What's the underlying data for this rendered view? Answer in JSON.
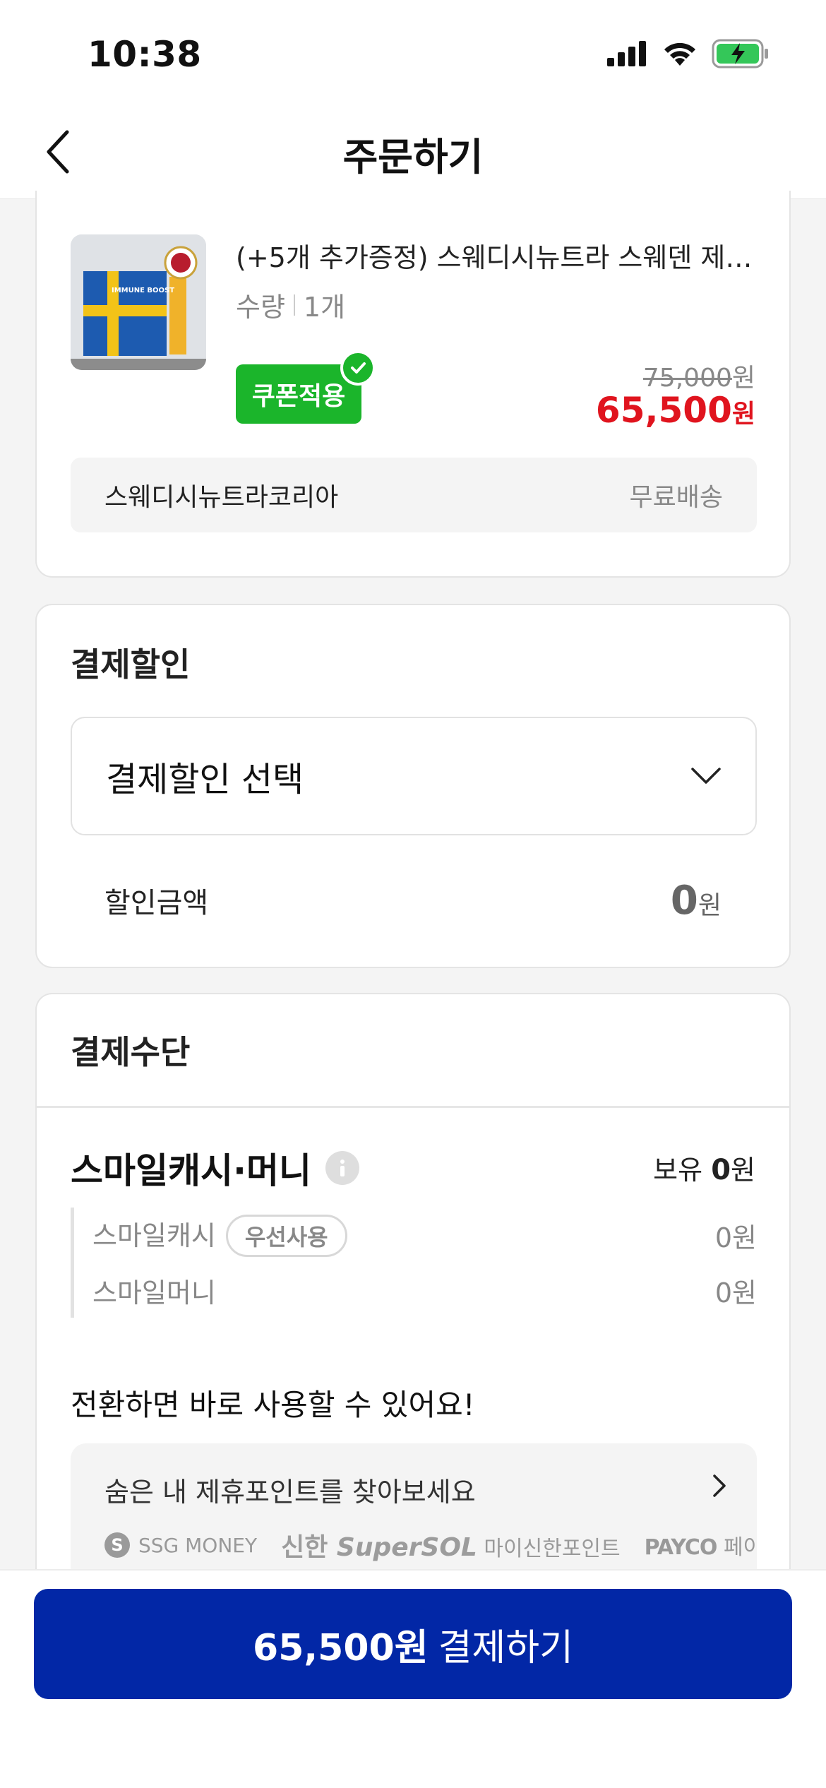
{
  "status_bar": {
    "time": "10:38"
  },
  "header": {
    "title": "주문하기"
  },
  "product": {
    "title": "(+5개 추가증정) 스웨디시뉴트라 스웨덴 제…",
    "qty_label": "수량",
    "qty_value": "1개",
    "coupon_badge": "쿠폰적용",
    "original_price": "75,000",
    "original_unit": "원",
    "sale_price": "65,500",
    "sale_unit": "원",
    "seller": "스웨디시뉴트라코리아",
    "shipping": "무료배송",
    "thumbnail_text": "IMMUNE BOOST"
  },
  "payment_discount": {
    "title": "결제할인",
    "select_placeholder": "결제할인 선택",
    "amount_label": "할인금액",
    "amount_value": "0",
    "amount_unit": "원"
  },
  "payment_method": {
    "title": "결제수단",
    "smile_title": "스마일캐시·머니",
    "hold_label": "보유",
    "hold_value": "0",
    "hold_unit": "원",
    "items": [
      {
        "label": "스마일캐시",
        "tag": "우선사용",
        "value": "0원"
      },
      {
        "label": "스마일머니",
        "tag": "",
        "value": "0원"
      }
    ],
    "convert_title": "전환하면 바로 사용할 수 있어요!",
    "promo_text": "숨은 내 제휴포인트를 찾아보세요",
    "partners": {
      "ssg": "SSG MONEY",
      "shinhan_brand": "신한",
      "shinhan_super": "Super",
      "shinhan_sol": "SOL",
      "shinhan_point": "마이신한포인트",
      "payco": "PAYCO",
      "payco_suffix": "페이코"
    }
  },
  "cta": {
    "amount": "65,500원",
    "label": "결제하기"
  },
  "colors": {
    "accent": "#0227a6",
    "coupon": "#1bb52b",
    "sale": "#e0141e"
  }
}
